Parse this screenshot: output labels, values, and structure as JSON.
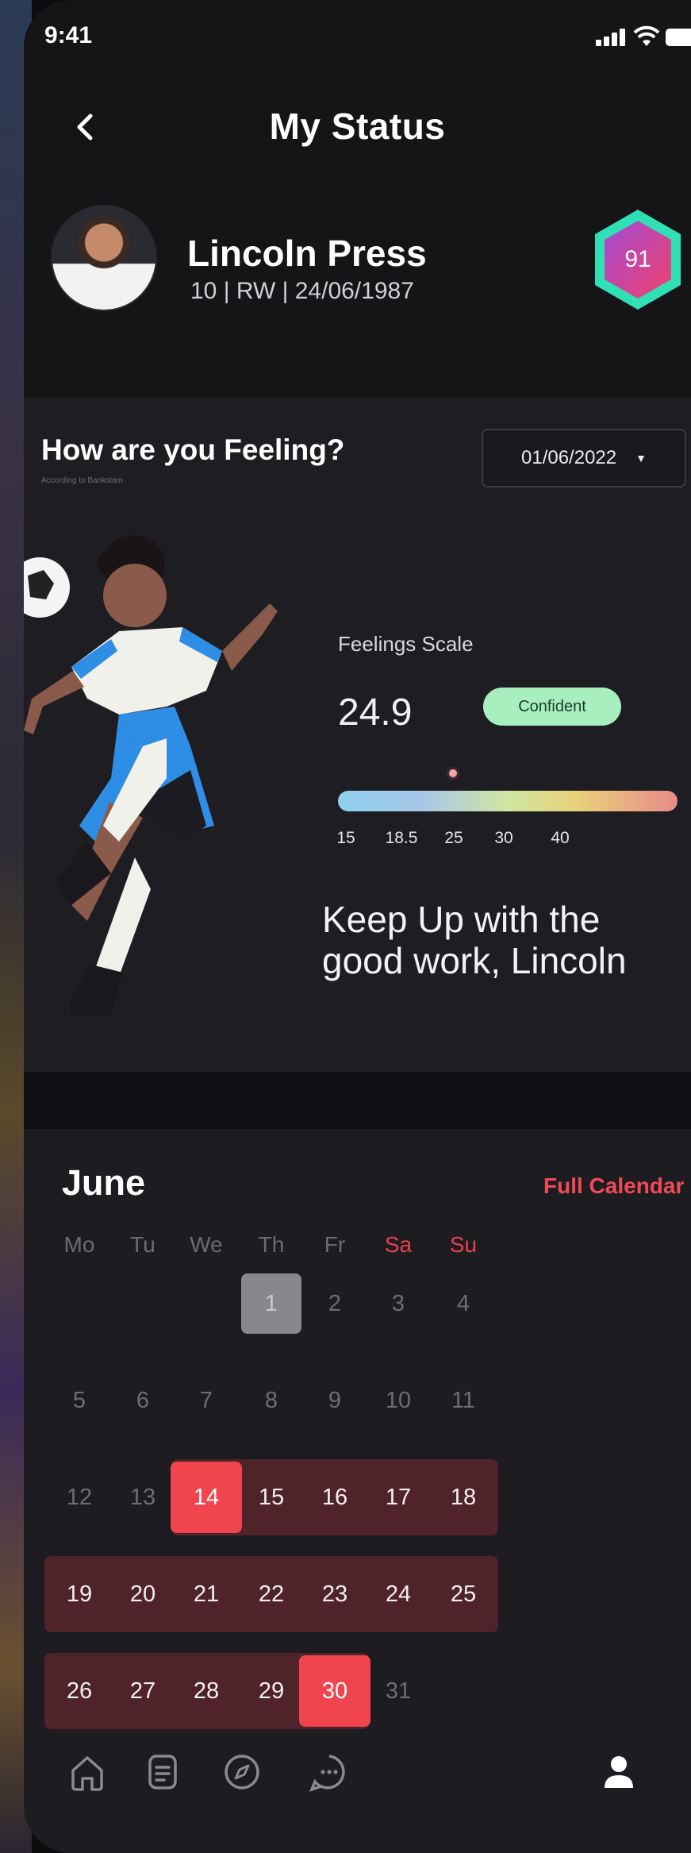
{
  "status_bar": {
    "time": "9:41"
  },
  "header": {
    "title": "My Status",
    "player_name": "Lincoln Press",
    "player_meta": "10 | RW | 24/06/1987",
    "rating": "91"
  },
  "feeling": {
    "title": "How are you Feeling?",
    "subtitle": "According to Bankstam",
    "date": "01/06/2022",
    "scale": {
      "title": "Feelings Scale",
      "value": "24.9",
      "value_number": 24.9,
      "status": "Confident",
      "range": [
        15,
        40
      ],
      "ticks": [
        "15",
        "18.5",
        "25",
        "30",
        "40"
      ]
    },
    "message_line1": "Keep Up with the",
    "message_line2": "good work, Lincoln"
  },
  "calendar": {
    "month": "June",
    "full_calendar_label": "Full Calendar",
    "weekdays": [
      "Mo",
      "Tu",
      "We",
      "Th",
      "Fr",
      "Sa",
      "Su"
    ],
    "first_weekday_index": 3,
    "days_in_month": 31,
    "today": 1,
    "range_start": 14,
    "range_end": 30,
    "colors": {
      "accent": "#f0454f",
      "range": "#502229",
      "today": "#88878d"
    }
  },
  "tabbar": {
    "items": [
      "home-icon",
      "document-icon",
      "compass-icon",
      "chat-icon",
      "profile-icon"
    ]
  }
}
